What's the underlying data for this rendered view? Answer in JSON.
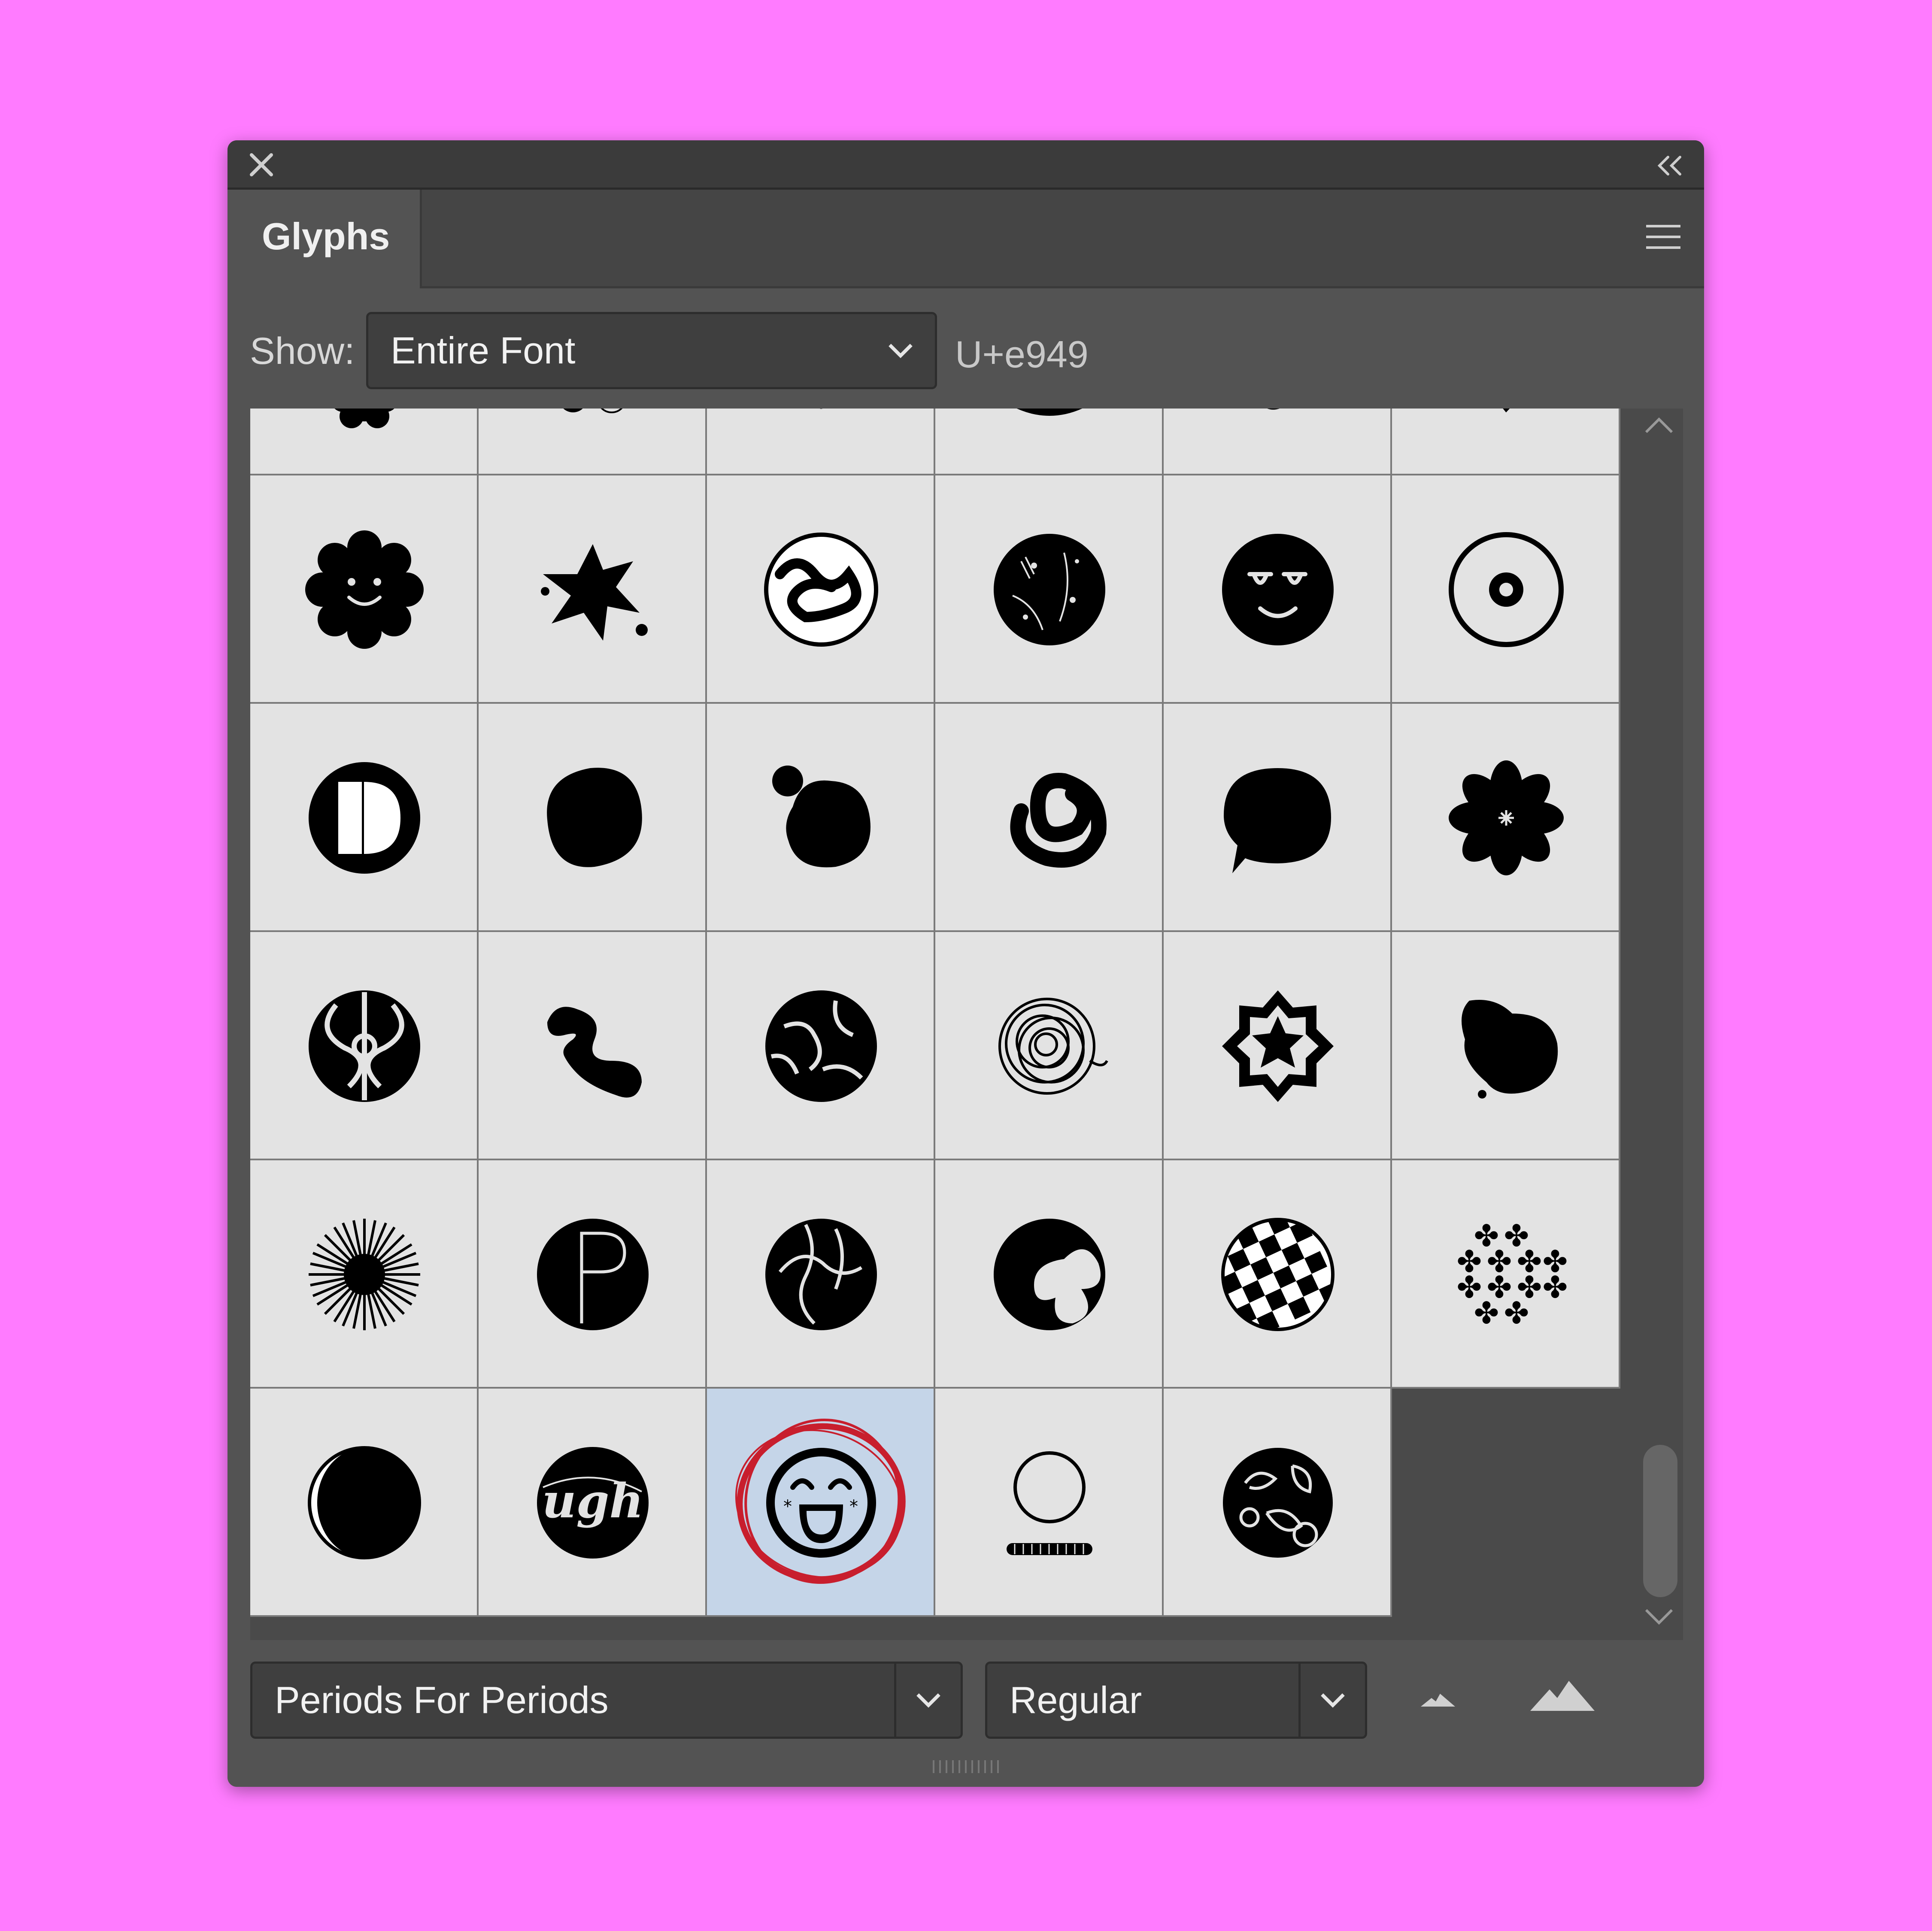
{
  "panel": {
    "title": "Glyphs",
    "show_label": "Show:",
    "show_value": "Entire Font",
    "unicode": "U+e949",
    "font_family": "Periods For Periods",
    "font_style": "Regular"
  },
  "glyph_grid": {
    "rows": [
      [
        "flower-smile",
        "paint-splat",
        "squiggle-circle",
        "floral-circle",
        "sleepy-face",
        "target-ring"
      ],
      [
        "d-circle",
        "rough-blob",
        "splat-blob",
        "scribble-knot",
        "speech-bubble",
        "daisy"
      ],
      [
        "ornate-pattern",
        "wavy-z",
        "cracked-circle",
        "scribble-ball",
        "star-badge",
        "ink-blot"
      ],
      [
        "starburst",
        "p-circle",
        "petal-circle",
        "x-circle",
        "checker-sphere",
        "flower-cluster"
      ],
      [
        "crescent-moon",
        "ugh-circle",
        "laughing-face",
        "ring-with-base",
        "rose-circle"
      ]
    ],
    "selected": "laughing-face",
    "selection_highlight": "#c5d5e8",
    "annotation_color": "#c81e2d"
  },
  "colors": {
    "background": "#ff7bff",
    "panel": "#535353",
    "titlebar": "#3b3b3b",
    "cell": "#e3e3e3"
  }
}
